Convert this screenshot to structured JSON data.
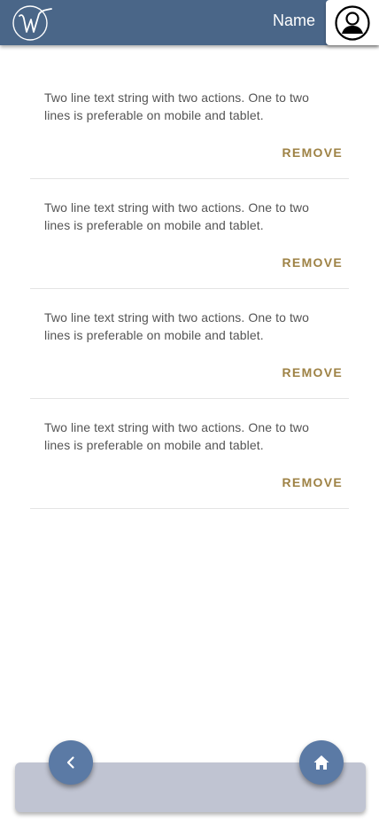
{
  "header": {
    "user_name": "Name",
    "background_color": "#4a6688",
    "logo_icon": "script-w-logo",
    "avatar_icon": "user-avatar-icon"
  },
  "items": [
    {
      "text": "Two line text string with two actions. One to two lines is preferable on mobile and tablet.",
      "action_label": "REMOVE"
    },
    {
      "text": "Two line text string with two actions. One to two lines is preferable on mobile and tablet.",
      "action_label": "REMOVE"
    },
    {
      "text": "Two line text string with two actions. One to two lines is preferable on mobile and tablet.",
      "action_label": "REMOVE"
    },
    {
      "text": "Two line text string with two actions. One to two lines is preferable on mobile and tablet.",
      "action_label": "REMOVE"
    }
  ],
  "bottom_nav": {
    "back_icon": "chevron-left-icon",
    "home_icon": "home-icon",
    "fab_color": "#5b7aa5",
    "bar_color": "#c0c4d2"
  },
  "colors": {
    "action": "#9e8245",
    "body_text": "#545454"
  }
}
